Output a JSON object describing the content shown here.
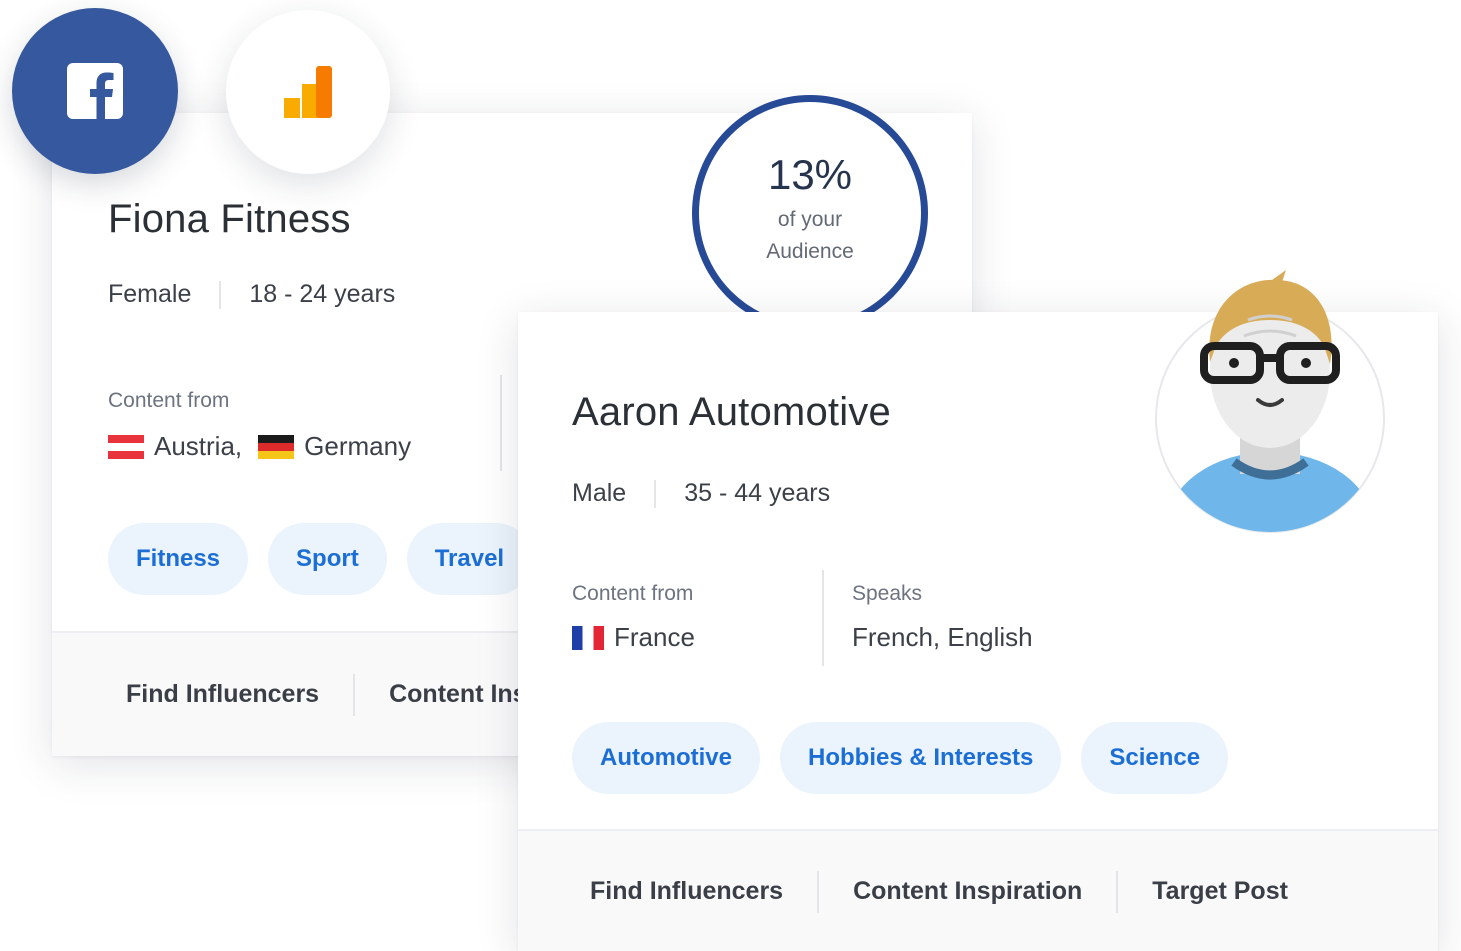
{
  "back_card": {
    "name": "Fiona Fitness",
    "gender": "Female",
    "age": "18 - 24 years",
    "content_from_label": "Content from",
    "countries": [
      {
        "name": "Austria,",
        "flag": "austria-flag"
      },
      {
        "name": "Germany",
        "flag": "germany-flag"
      }
    ],
    "tags": [
      "Fitness",
      "Sport",
      "Travel"
    ],
    "footer": {
      "find_influencers": "Find Influencers",
      "content": "Content Inspiration"
    }
  },
  "audience_badge": {
    "percent": "13%",
    "line1": "of your",
    "line2": "Audience",
    "ring_color": "#274a96"
  },
  "front_card": {
    "name": "Aaron Automotive",
    "gender": "Male",
    "age": "35 - 44 years",
    "content_from_label": "Content from",
    "country": "France",
    "speaks_label": "Speaks",
    "languages": "French, English",
    "tags": [
      "Automotive",
      "Hobbies & Interests",
      "Science"
    ],
    "footer": {
      "find_influencers": "Find Influencers",
      "content_inspiration": "Content Inspiration",
      "target_post": "Target Post"
    }
  },
  "icons": {
    "facebook": "facebook-icon",
    "analytics": "google-analytics-icon",
    "avatar": "avatar-glasses"
  },
  "colors": {
    "tag_bg": "#ebf3fc",
    "tag_text": "#1b6ed6",
    "facebook": "#36589e",
    "analytics_orange": "#f57c00",
    "analytics_yellow": "#f9ab00"
  }
}
